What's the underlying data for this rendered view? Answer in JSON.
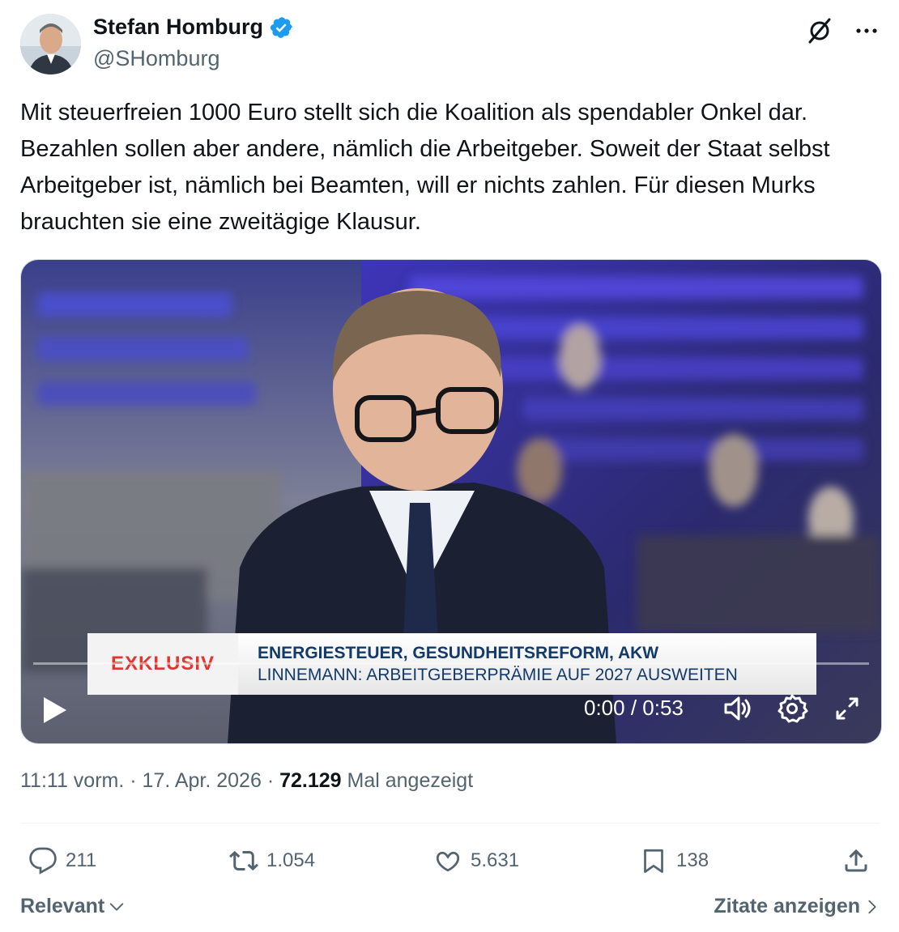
{
  "author": {
    "name": "Stefan Homburg",
    "handle": "@SHomburg",
    "verified": true,
    "verified_color": "#1d9bf0"
  },
  "header_icons": [
    "grok-icon",
    "more-icon"
  ],
  "tweet": {
    "text": "Mit steuerfreien 1000 Euro stellt sich die Koalition als spendabler Onkel dar. Bezahlen sollen aber andere, nämlich die Arbeitgeber. Soweit der Staat selbst Arbeitgeber ist, nämlich bei Beamten, will er nichts zahlen. Für diesen Murks brauchten sie eine zweitägige Klausur."
  },
  "video": {
    "lower_third": {
      "tag": "EXKLUSIV",
      "headline": "ENERGIESTEUER, GESUNDHEITSREFORM, AKW",
      "subline": "LINNEMANN: ARBEITGEBERPRÄMIE AUF 2027 AUSWEITEN"
    },
    "time_display": "0:00 / 0:53",
    "progress": 0
  },
  "meta": {
    "time": "11:11 vorm.",
    "separator": " · ",
    "date": "17. Apr. 2026",
    "views": "72.129",
    "views_label": " Mal angezeigt"
  },
  "actions": {
    "replies": "211",
    "reposts": "1.054",
    "likes": "5.631",
    "bookmarks": "138"
  },
  "footer": {
    "sort_label": "Relevant",
    "quotes_label": "Zitate anzeigen"
  },
  "colors": {
    "text_primary": "#0f1419",
    "text_secondary": "#536471",
    "accent": "#1d9bf0",
    "tag_red": "#e3342f",
    "lower_third_text": "#123a6b"
  }
}
